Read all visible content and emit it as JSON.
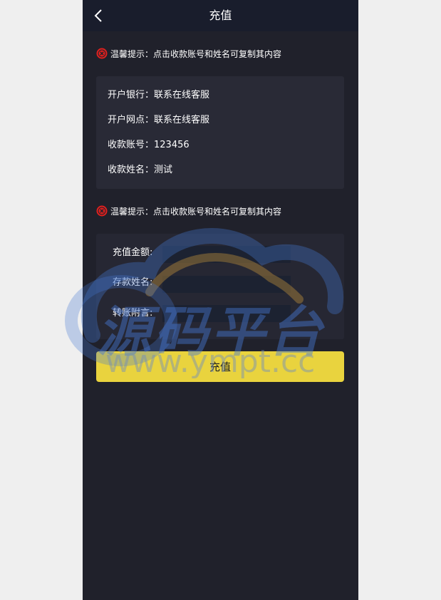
{
  "header": {
    "title": "充值",
    "back_icon": "chevron-left-icon"
  },
  "tips": [
    {
      "icon": "close-circle-icon",
      "text": "温馨提示：点击收款账号和姓名可复制其内容"
    },
    {
      "icon": "close-circle-icon",
      "text": "温馨提示：点击收款账号和姓名可复制其内容"
    }
  ],
  "bank_info": {
    "bank": "开户银行：联系在线客服",
    "branch": "开户网点：联系在线客服",
    "account": "收款账号：123456",
    "name": "收款姓名：测试"
  },
  "form": {
    "amount_label": "充值金额:",
    "amount_value": "",
    "depositor_label": "存款姓名:",
    "depositor_value": "",
    "note_label": "转账附言:",
    "note_value": ""
  },
  "submit_label": "充值",
  "watermark": {
    "text": "源码平台",
    "url": "www.ympt.cc"
  },
  "colors": {
    "page_bg": "#20212b",
    "header_bg": "#191d2c",
    "card_bg": "#292a36",
    "button": "#e9d33e",
    "tip_icon": "#e0201e"
  }
}
